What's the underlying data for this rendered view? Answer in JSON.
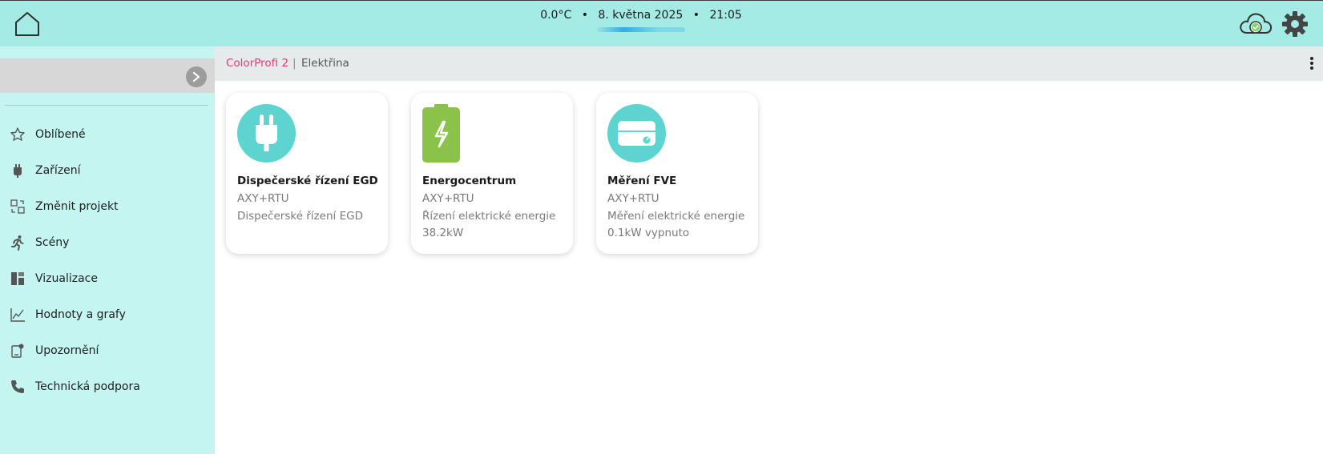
{
  "header": {
    "temperature": "0.0°C",
    "date": "8. května 2025",
    "time": "21:05",
    "separator": "•"
  },
  "sidebar": {
    "items": [
      {
        "label": "Oblíbené",
        "icon": "star-icon"
      },
      {
        "label": "Zařízení",
        "icon": "plug-icon"
      },
      {
        "label": "Změnit projekt",
        "icon": "switch-project-icon"
      },
      {
        "label": "Scény",
        "icon": "running-person-icon"
      },
      {
        "label": "Vizualizace",
        "icon": "visualization-icon"
      },
      {
        "label": "Hodnoty a grafy",
        "icon": "line-chart-icon"
      },
      {
        "label": "Upozornění",
        "icon": "notification-icon"
      },
      {
        "label": "Technická podpora",
        "icon": "phone-icon"
      }
    ]
  },
  "breadcrumb": {
    "project": "ColorProfi 2",
    "separator": "|",
    "page": "Elektřina"
  },
  "cards": [
    {
      "title": "Dispečerské řízení EGD",
      "line1": "AXY+RTU",
      "line2": "Dispečerské řízení EGD",
      "line3": "",
      "icon": "plug-icon"
    },
    {
      "title": "Energocentrum",
      "line1": "AXY+RTU",
      "line2": "Řízení elektrické energie",
      "line3": "38.2kW",
      "icon": "battery-icon"
    },
    {
      "title": "Měření FVE",
      "line1": "AXY+RTU",
      "line2": "Měření elektrické energie",
      "line3": "0.1kW vypnuto",
      "icon": "meter-icon"
    }
  ],
  "colors": {
    "header_bg": "#a4ebe5",
    "sidebar_bg": "#c4f5f0",
    "accent_pink": "#e8357a",
    "icon_teal": "#5dd4d0",
    "icon_green": "#8bc34a"
  }
}
